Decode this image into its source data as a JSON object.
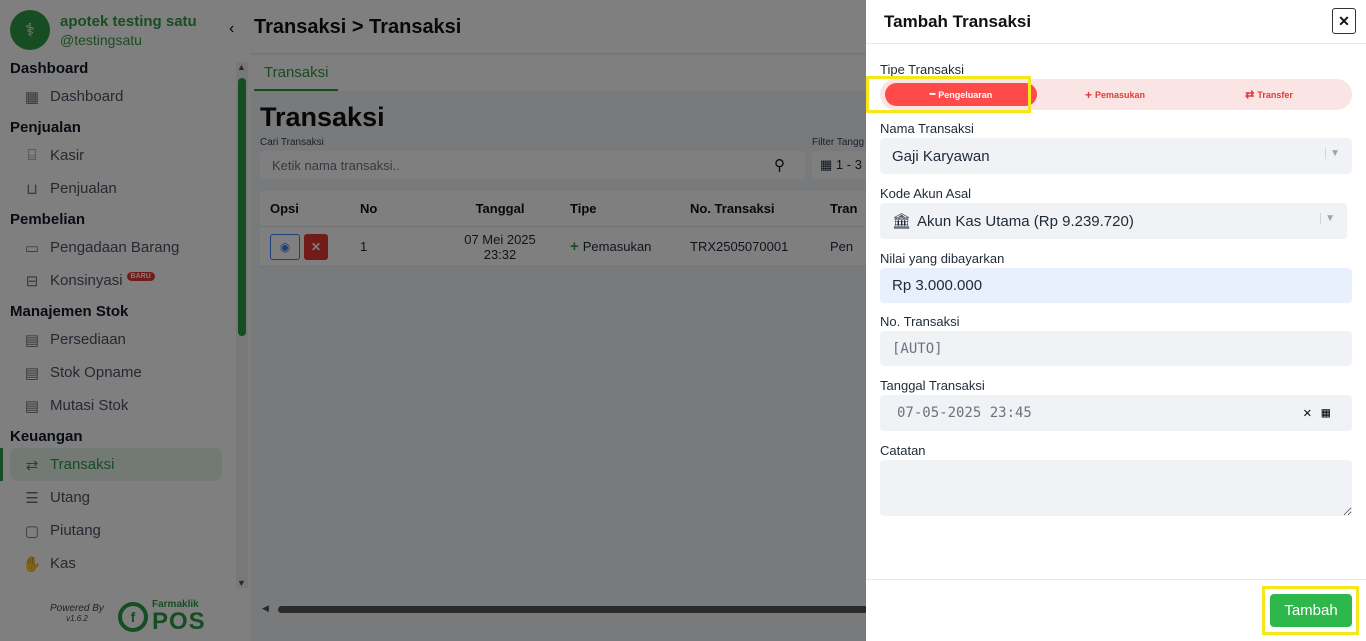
{
  "brand": {
    "name": "apotek testing satu",
    "handle": "@testingsatu"
  },
  "sidebar": {
    "sections": [
      {
        "title": "Dashboard",
        "items": [
          {
            "label": "Dashboard",
            "icon": "grid-icon"
          }
        ]
      },
      {
        "title": "Penjualan",
        "items": [
          {
            "label": "Kasir",
            "icon": "cash-register-icon"
          },
          {
            "label": "Penjualan",
            "icon": "basket-icon"
          }
        ]
      },
      {
        "title": "Pembelian",
        "items": [
          {
            "label": "Pengadaan Barang",
            "icon": "box-icon"
          },
          {
            "label": "Konsinyasi",
            "icon": "archive-icon",
            "badge": "BARU"
          }
        ]
      },
      {
        "title": "Manajemen Stok",
        "items": [
          {
            "label": "Persediaan",
            "icon": "clipboard-icon"
          },
          {
            "label": "Stok Opname",
            "icon": "clipboard-check-icon"
          },
          {
            "label": "Mutasi Stok",
            "icon": "clipboard-move-icon"
          }
        ]
      },
      {
        "title": "Keuangan",
        "items": [
          {
            "label": "Transaksi",
            "icon": "exchange-icon",
            "active": true
          },
          {
            "label": "Utang",
            "icon": "list-icon"
          },
          {
            "label": "Piutang",
            "icon": "note-icon"
          },
          {
            "label": "Kas",
            "icon": "hand-coin-icon"
          }
        ]
      }
    ],
    "powered_by": "Powered By",
    "version": "v1.6.2",
    "pos_logo_small": "Farmaklik",
    "pos_logo_big": "POS"
  },
  "header": {
    "breadcrumb": "Transaksi > Transaksi"
  },
  "tabs": [
    "Transaksi"
  ],
  "main": {
    "title": "Transaksi",
    "search": {
      "label": "Cari Transaksi",
      "placeholder": "Ketik nama transaksi.."
    },
    "filter": {
      "label": "Filter Tangg",
      "value": "1 - 3"
    },
    "table": {
      "columns": [
        "Opsi",
        "No",
        "Tanggal",
        "Tipe",
        "No. Transaksi",
        "Tran"
      ],
      "rows": [
        {
          "no": "1",
          "date_line1": "07 Mei 2025",
          "date_line2": "23:32",
          "type": "Pemasukan",
          "trx_no": "TRX2505070001",
          "trx_name": "Pen"
        }
      ]
    }
  },
  "drawer": {
    "title": "Tambah Transaksi",
    "type_label": "Tipe Transaksi",
    "types": [
      "Pengeluaran",
      "Pemasukan",
      "Transfer"
    ],
    "selected_type": "Pengeluaran",
    "name_label": "Nama Transaksi",
    "name_value": "Gaji Karyawan",
    "account_label": "Kode Akun Asal",
    "account_value": "Akun Kas Utama (Rp 9.239.720)",
    "amount_label": "Nilai yang dibayarkan",
    "amount_value": "Rp 3.000.000",
    "trx_no_label": "No. Transaksi",
    "trx_no_value": "[AUTO]",
    "date_label": "Tanggal Transaksi",
    "date_value": "07-05-2025 23:45",
    "notes_label": "Catatan",
    "notes_value": "",
    "submit_label": "Tambah"
  },
  "colors": {
    "brand_green": "#2e9b47",
    "danger_red": "#ff4a4a",
    "highlight_yellow": "#f5e71a"
  }
}
